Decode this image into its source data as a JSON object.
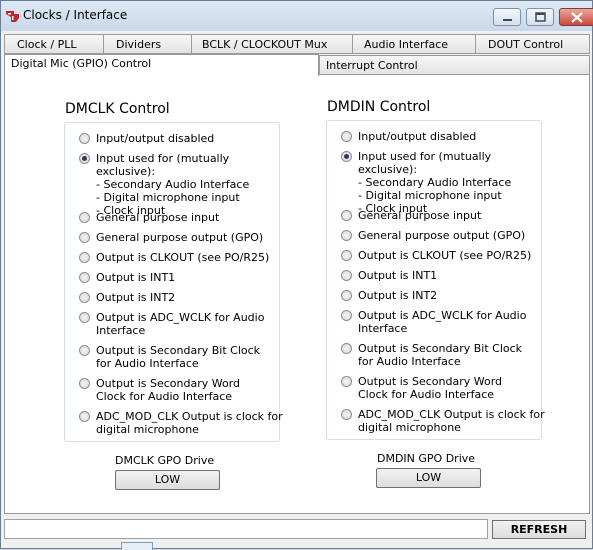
{
  "window": {
    "title": "Clocks / Interface",
    "accent_close": "#c8483a"
  },
  "tabs_row1": [
    {
      "label": "Clock / PLL"
    },
    {
      "label": "Dividers"
    },
    {
      "label": "BCLK / CLOCKOUT  Mux"
    },
    {
      "label": "Audio Interface"
    },
    {
      "label": "DOUT Control"
    }
  ],
  "tabs_row2": [
    {
      "label": "Digital Mic (GPIO) Control",
      "active": true
    },
    {
      "label": "Interrupt Control",
      "active": false
    }
  ],
  "dmclk": {
    "title": "DMCLK Control",
    "options": [
      {
        "label": "Input/output disabled",
        "checked": false
      },
      {
        "label": "Input used for (mutually exclusive):\n- Secondary Audio Interface\n- Digital microphone input\n- Clock input",
        "checked": true
      },
      {
        "label": "General purpose input",
        "checked": false
      },
      {
        "label": "General purpose output (GPO)",
        "checked": false
      },
      {
        "label": "Output is CLKOUT (see PO/R25)",
        "checked": false
      },
      {
        "label": "Output is INT1",
        "checked": false
      },
      {
        "label": "Output is INT2",
        "checked": false
      },
      {
        "label": "Output is ADC_WCLK for Audio\nInterface",
        "checked": false
      },
      {
        "label": "Output is Secondary Bit Clock\nfor Audio Interface",
        "checked": false
      },
      {
        "label": "Output is Secondary Word\nClock for Audio Interface",
        "checked": false
      },
      {
        "label": "ADC_MOD_CLK Output is clock for\ndigital microphone",
        "checked": false
      }
    ],
    "gpo_drive_label": "DMCLK GPO Drive",
    "gpo_drive_value": "LOW"
  },
  "dmdin": {
    "title": "DMDIN Control",
    "options": [
      {
        "label": "Input/output disabled",
        "checked": false
      },
      {
        "label": "Input used for (mutually exclusive):\n- Secondary Audio Interface\n- Digital microphone input\n- Clock input",
        "checked": true
      },
      {
        "label": "General purpose input",
        "checked": false
      },
      {
        "label": "General purpose output (GPO)",
        "checked": false
      },
      {
        "label": "Output is CLKOUT (see PO/R25)",
        "checked": false
      },
      {
        "label": "Output is INT1",
        "checked": false
      },
      {
        "label": "Output is INT2",
        "checked": false
      },
      {
        "label": "Output is ADC_WCLK for Audio\nInterface",
        "checked": false
      },
      {
        "label": "Output is Secondary Bit Clock\nfor Audio Interface",
        "checked": false
      },
      {
        "label": "Output is Secondary Word\nClock for Audio Interface",
        "checked": false
      },
      {
        "label": "ADC_MOD_CLK Output is clock for\ndigital microphone",
        "checked": false
      }
    ],
    "gpo_drive_label": "DMDIN GPO Drive",
    "gpo_drive_value": "LOW"
  },
  "footer": {
    "status_text": "",
    "refresh_label": "REFRESH"
  }
}
